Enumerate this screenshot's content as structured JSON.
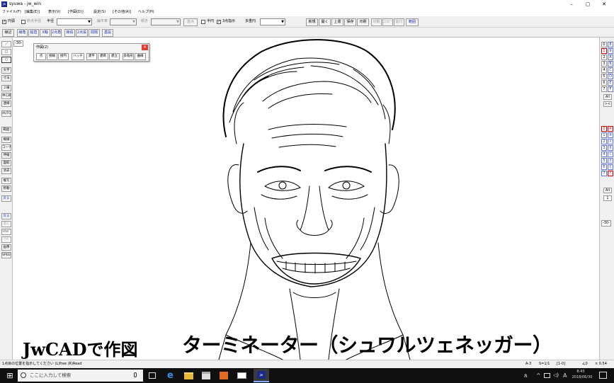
{
  "window": {
    "title": "syuwa - jw_win",
    "app_icon_label": "jw",
    "controls": {
      "minimize": "–",
      "maximize": "▢",
      "close": "✕"
    }
  },
  "menu": [
    "ファイル(F)",
    "[編集(E)]",
    "表示(V)",
    "[作図(D)]",
    "設定(S)",
    "[その他(A)]",
    "ヘルプ(H)"
  ],
  "toolbar1": {
    "circle_check": "✓",
    "circle_label": "円弧",
    "fixed_radius_label": "終点半径",
    "radius_label": "半径",
    "flatness_label": "扁平率",
    "tilt_label": "傾き",
    "base_point_button": "基点",
    "semicircle_label": "半円",
    "three_point_check": "✓",
    "three_point_label": "3点指示",
    "multi_circle_label": "多重円",
    "right_buttons": [
      "新規",
      "開く",
      "上書",
      "保存",
      "印刷",
      "切取",
      "コピー",
      "貼付",
      "範囲"
    ]
  },
  "toolbar2": [
    "線記",
    "線角",
    "鉛直",
    "X軸",
    "2点角",
    "線長",
    "2点長",
    "間隔",
    "基設"
  ],
  "left_tools": [
    "／",
    "□",
    "○",
    "文字",
    "寸法",
    "２線",
    "中心線",
    "連線",
    "AUTO",
    "範囲",
    "複線",
    "コーナー",
    "伸縮",
    "面取",
    "消去",
    "複写",
    "移動",
    "戻る",
    "戻る",
    "進む",
    "ｿﾘｯﾄﾞ",
    "ｱﾙﾘ",
    "画像",
    "SPEED"
  ],
  "left_scale_readout": "-30-",
  "right_layer_groups": {
    "row1": [
      [
        "0",
        "8"
      ],
      [
        "1",
        "9"
      ],
      [
        "2",
        "A"
      ],
      [
        "3",
        "B"
      ],
      [
        "4",
        "C"
      ],
      [
        "5",
        "D"
      ],
      [
        "6",
        "E"
      ],
      [
        "7",
        "F"
      ]
    ],
    "all_label": "All",
    "x_label": "><",
    "row2": [
      [
        "0",
        "⑧"
      ],
      [
        "1",
        "⑨"
      ],
      [
        "2",
        "Ⓐ"
      ],
      [
        "3",
        "Ⓑ"
      ],
      [
        "4",
        "Ⓒ"
      ],
      [
        "5",
        "Ⓓ"
      ],
      [
        "6",
        "Ⓔ"
      ],
      [
        "7",
        "Ⓕ"
      ]
    ],
    "all2_label": "All",
    "one_label": "1",
    "scale_readout": "-30-"
  },
  "popup": {
    "title": "作図(2)",
    "close": "×",
    "buttons": [
      "点",
      "接線",
      "接円",
      "ハッチ",
      "建平",
      "建断",
      "建立",
      "多角形",
      "曲線"
    ]
  },
  "overlay_text": {
    "left": "JwCADで作図",
    "right": "ターミネーター（シュワルツェネッガー）"
  },
  "status": {
    "message": "1点目の位置を指示してください (L)free (R)Read",
    "paper": "A-3",
    "scale": "S=1/1",
    "layer": "[1-0]",
    "angle": "∠0",
    "zoom": "× 0.54"
  },
  "taskbar": {
    "start_icon": "⊞",
    "search_placeholder": "ここに入力して検索",
    "mic": "🎤",
    "time": "8:43",
    "date": "2018/06/30",
    "ime": "A"
  }
}
